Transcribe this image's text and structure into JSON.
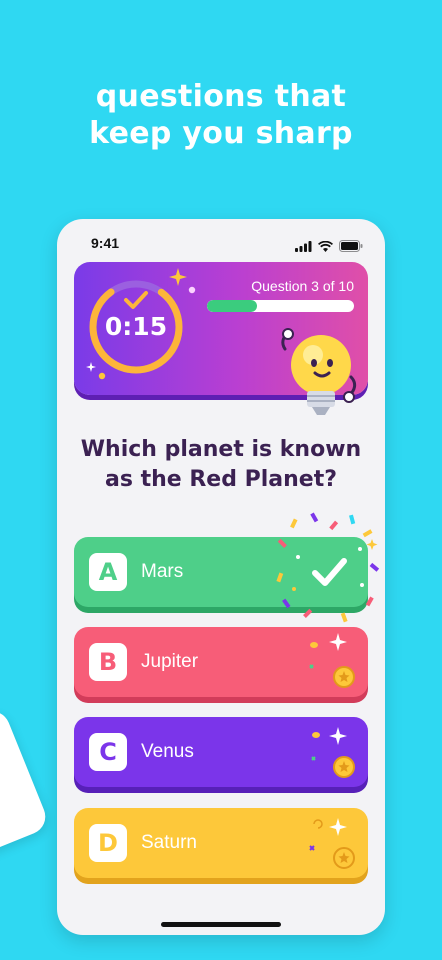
{
  "headline": {
    "line1": "questions that",
    "line2": "keep you sharp"
  },
  "status_bar": {
    "time": "9:41",
    "icons": [
      "signal-icon",
      "wifi-icon",
      "battery-icon"
    ]
  },
  "hero": {
    "timer": "0:15",
    "question_counter": "Question 3 of 10",
    "progress": 0.34,
    "timer_fraction": 0.8,
    "mascot": "lightbulb-mascot-icon"
  },
  "question": {
    "line1": "Which planet is known",
    "line2": "as the Red Planet?"
  },
  "answers": [
    {
      "letter": "A",
      "label": "Mars",
      "state": "correct"
    },
    {
      "letter": "B",
      "label": "Jupiter",
      "state": "default"
    },
    {
      "letter": "C",
      "label": "Venus",
      "state": "default"
    },
    {
      "letter": "D",
      "label": "Saturn",
      "state": "default"
    }
  ],
  "colors": {
    "background": "#2fd8f2",
    "correct": "#4ecf89",
    "answer_b": "#f75d78",
    "answer_c": "#7b35ea",
    "answer_d": "#fdc83a",
    "question_text": "#3b2152"
  }
}
